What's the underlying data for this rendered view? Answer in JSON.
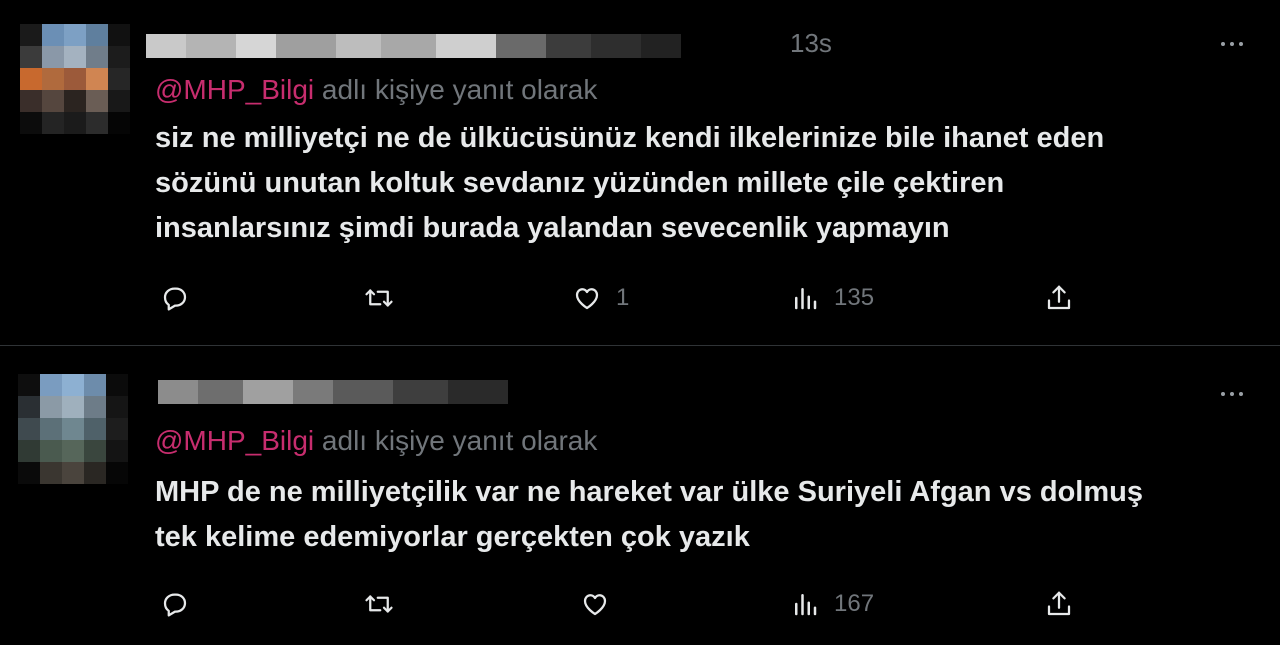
{
  "tweets": [
    {
      "timestamp": "13s",
      "reply_mention": "@MHP_Bilgi",
      "reply_suffix": "adlı kişiye yanıt olarak",
      "text": "siz ne milliyetçi ne de ülkücüsünüz kendi ilkelerinize bile ihanet eden\nsözünü unutan koltuk sevdanız yüzünden millete çile çektiren\ninsanlarsınız şimdi burada yalandan sevecenlik yapmayın",
      "like_count": "1",
      "view_count": "135"
    },
    {
      "reply_mention": "@MHP_Bilgi",
      "reply_suffix": "adlı kişiye yanıt olarak",
      "text": "MHP de ne milliyetçilik var ne hareket var ülke Suriyeli Afgan vs dolmuş\ntek kelime edemiyorlar gerçekten çok yazık",
      "view_count": "167"
    }
  ],
  "icons": {
    "reply": "reply-icon",
    "retweet": "retweet-icon",
    "like": "heart-icon",
    "views": "views-icon",
    "share": "share-icon",
    "more": "more-icon"
  },
  "colors": {
    "background": "#000000",
    "text": "#e7e9ea",
    "muted": "#71767b",
    "mention": "#c72d6e",
    "divider": "#2f3336"
  }
}
